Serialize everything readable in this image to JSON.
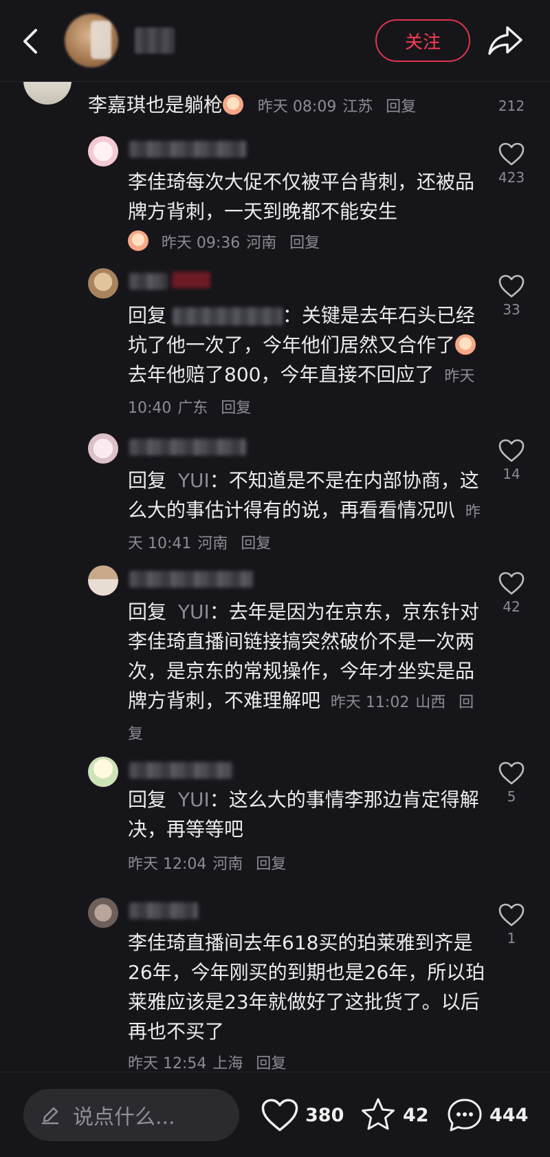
{
  "header": {
    "follow_label": "关注"
  },
  "comments": [
    {
      "text": "李嘉琪也是躺枪",
      "time": "昨天 08:09",
      "location": "江苏",
      "reply_label": "回复",
      "likes": "212"
    },
    {
      "text": "李佳琦每次大促不仅被平台背刺，还被品牌方背刺，一天到晚都不能安生",
      "time": "昨天 09:36",
      "location": "河南",
      "reply_label": "回复",
      "likes": "423"
    },
    {
      "reply_prefix": "回复",
      "text": "：关键是去年石头已经坑了他一次了，今年他们居然又合作了",
      "text2": "去年他赔了800，今年直接不回应了",
      "time": "昨天 10:40",
      "location": "广东",
      "reply_label": "回复",
      "likes": "33"
    },
    {
      "reply_prefix": "回复",
      "reply_to": "YUI",
      "text": "：不知道是不是在内部协商，这么大的事估计得有的说，再看看情况叭",
      "time": "昨天 10:41",
      "location": "河南",
      "reply_label": "回复",
      "likes": "14"
    },
    {
      "reply_prefix": "回复",
      "reply_to": "YUI",
      "text": "：去年是因为在京东，京东针对李佳琦直播间链接搞突然破价不是一次两次，是京东的常规操作，今年才坐实是品牌方背刺，不难理解吧",
      "time": "昨天 11:02",
      "location": "山西",
      "reply_label": "回复",
      "likes": "42"
    },
    {
      "reply_prefix": "回复",
      "reply_to": "YUI",
      "text": "：这么大的事情李那边肯定得解决，再等等吧",
      "time": "昨天 12:04",
      "location": "河南",
      "reply_label": "回复",
      "likes": "5"
    },
    {
      "text": "李佳琦直播间去年618买的珀莱雅到齐是26年，今年刚买的到期也是26年，所以珀莱雅应该是23年就做好了这批货了。以后再也不买了",
      "time": "昨天 12:54",
      "location": "上海",
      "reply_label": "回复",
      "likes": "1"
    }
  ],
  "bottom": {
    "input_placeholder": "说点什么...",
    "likes": "380",
    "favorites": "42",
    "comments": "444"
  },
  "colors": {
    "background": "#16161a",
    "accent": "#e2354b",
    "muted": "#8c8c93"
  }
}
